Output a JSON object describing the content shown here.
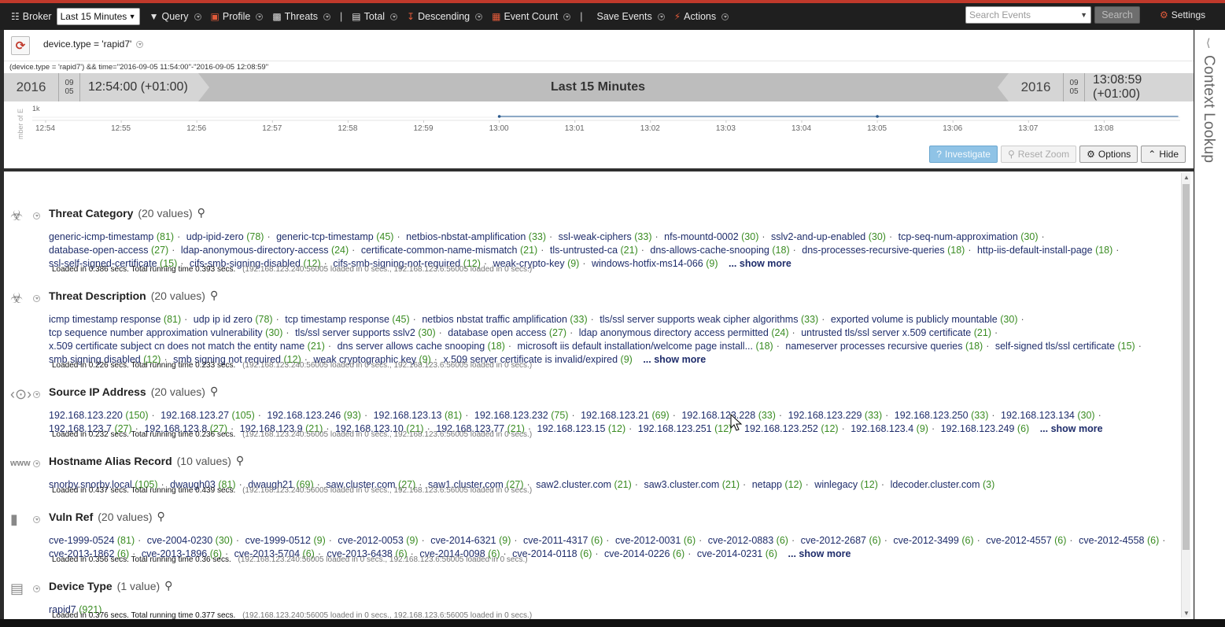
{
  "toolbar": {
    "broker": "Broker",
    "time_range": "Last 15 Minutes",
    "query": "Query",
    "profile": "Profile",
    "threats": "Threats",
    "total": "Total",
    "descending": "Descending",
    "event_count": "Event Count",
    "save_events": "Save Events",
    "actions": "Actions",
    "search_placeholder": "Search Events",
    "search_button": "Search",
    "settings": "Settings"
  },
  "query": {
    "pill": "device.type = 'rapid7'",
    "string": "(device.type = 'rapid7') && time=\"2016-09-05 11:54:00\"-\"2016-09-05 12:08:59\""
  },
  "timeline": {
    "start_year": "2016",
    "start_month": "09",
    "start_day": "05",
    "start_time": "12:54:00 (+01:00)",
    "label": "Last 15 Minutes",
    "end_year": "2016",
    "end_month": "09",
    "end_day": "05",
    "end_time": "13:08:59 (+01:00)"
  },
  "chart_data": {
    "type": "line",
    "title": "",
    "xlabel": "",
    "ylabel": "mber of E",
    "y_tick": "1k",
    "categories": [
      "12:54",
      "12:55",
      "12:56",
      "12:57",
      "12:58",
      "12:59",
      "13:00",
      "13:01",
      "13:02",
      "13:03",
      "13:04",
      "13:05",
      "13:06",
      "13:07",
      "13:08"
    ],
    "x": [
      0,
      1,
      2,
      3,
      4,
      5,
      6,
      7,
      8,
      9,
      10,
      11,
      12,
      13,
      14,
      14.98
    ],
    "values": [
      null,
      null,
      null,
      null,
      null,
      null,
      0,
      0,
      0,
      0,
      0,
      0,
      0,
      0,
      0,
      0
    ],
    "marker_x": [
      6,
      11
    ],
    "ylim": [
      0,
      1000
    ],
    "line_color": "#6a8fb5"
  },
  "chart_buttons": {
    "investigate": "Investigate",
    "reset_zoom": "Reset Zoom",
    "options": "Options",
    "hide": "Hide"
  },
  "meta": [
    {
      "icon": "biohazard-icon",
      "name": "Threat Category",
      "count": "(20 values)",
      "values": [
        [
          "generic-icmp-timestamp",
          "(81)"
        ],
        [
          "udp-ipid-zero",
          "(78)"
        ],
        [
          "generic-tcp-timestamp",
          "(45)"
        ],
        [
          "netbios-nbstat-amplification",
          "(33)"
        ],
        [
          "ssl-weak-ciphers",
          "(33)"
        ],
        [
          "nfs-mountd-0002",
          "(30)"
        ],
        [
          "sslv2-and-up-enabled",
          "(30)"
        ],
        [
          "tcp-seq-num-approximation",
          "(30)"
        ],
        [
          "database-open-access",
          "(27)"
        ],
        [
          "ldap-anonymous-directory-access",
          "(24)"
        ],
        [
          "certificate-common-name-mismatch",
          "(21)"
        ],
        [
          "tls-untrusted-ca",
          "(21)"
        ],
        [
          "dns-allows-cache-snooping",
          "(18)"
        ],
        [
          "dns-processes-recursive-queries",
          "(18)"
        ],
        [
          "http-iis-default-install-page",
          "(18)"
        ],
        [
          "ssl-self-signed-certificate",
          "(15)"
        ],
        [
          "cifs-smb-signing-disabled",
          "(12)"
        ],
        [
          "cifs-smb-signing-not-required",
          "(12)"
        ],
        [
          "weak-crypto-key",
          "(9)"
        ],
        [
          "windows-hotfix-ms14-066",
          "(9)"
        ]
      ],
      "more": "... show more",
      "loaded": "Loaded in 0.386 secs. Total running time 0.393 secs.",
      "detail": "(192.168.123.240:56005 loaded in 0 secs., 192.168.123.6:56005 loaded in 0 secs.)"
    },
    {
      "icon": "biohazard-icon",
      "name": "Threat Description",
      "count": "(20 values)",
      "values": [
        [
          "icmp timestamp response",
          "(81)"
        ],
        [
          "udp ip id zero",
          "(78)"
        ],
        [
          "tcp timestamp response",
          "(45)"
        ],
        [
          "netbios nbstat traffic amplification",
          "(33)"
        ],
        [
          "tls/ssl server supports weak cipher algorithms",
          "(33)"
        ],
        [
          "exported volume is publicly mountable",
          "(30)"
        ],
        [
          "tcp sequence number approximation vulnerability",
          "(30)"
        ],
        [
          "tls/ssl server supports sslv2",
          "(30)"
        ],
        [
          "database open access",
          "(27)"
        ],
        [
          "ldap anonymous directory access permitted",
          "(24)"
        ],
        [
          "untrusted tls/ssl server x.509 certificate",
          "(21)"
        ],
        [
          "x.509 certificate subject cn does not match the entity name",
          "(21)"
        ],
        [
          "dns server allows cache snooping",
          "(18)"
        ],
        [
          "microsoft iis default installation/welcome page install...",
          "(18)"
        ],
        [
          "nameserver processes recursive queries",
          "(18)"
        ],
        [
          "self-signed tls/ssl certificate",
          "(15)"
        ],
        [
          "smb signing disabled",
          "(12)"
        ],
        [
          "smb signing not required",
          "(12)"
        ],
        [
          "weak cryptographic key",
          "(9)"
        ],
        [
          "x.509 server certificate is invalid/expired",
          "(9)"
        ]
      ],
      "more": "... show more",
      "loaded": "Loaded in 0.226 secs. Total running time 0.233 secs.",
      "detail": "(192.168.123.240:56005 loaded in 0 secs., 192.168.123.6:56005 loaded in 0 secs.)"
    },
    {
      "icon": "network-address-icon",
      "name": "Source IP Address",
      "count": "(20 values)",
      "values": [
        [
          "192.168.123.220",
          "(150)"
        ],
        [
          "192.168.123.27",
          "(105)"
        ],
        [
          "192.168.123.246",
          "(93)"
        ],
        [
          "192.168.123.13",
          "(81)"
        ],
        [
          "192.168.123.232",
          "(75)"
        ],
        [
          "192.168.123.21",
          "(69)"
        ],
        [
          "192.168.123.228",
          "(33)"
        ],
        [
          "192.168.123.229",
          "(33)"
        ],
        [
          "192.168.123.250",
          "(33)"
        ],
        [
          "192.168.123.134",
          "(30)"
        ],
        [
          "192.168.123.7",
          "(27)"
        ],
        [
          "192.168.123.8",
          "(27)"
        ],
        [
          "192.168.123.9",
          "(21)"
        ],
        [
          "192.168.123.10",
          "(21)"
        ],
        [
          "192.168.123.77",
          "(21)"
        ],
        [
          "192.168.123.15",
          "(12)"
        ],
        [
          "192.168.123.251",
          "(12)"
        ],
        [
          "192.168.123.252",
          "(12)"
        ],
        [
          "192.168.123.4",
          "(9)"
        ],
        [
          "192.168.123.249",
          "(6)"
        ]
      ],
      "more": "... show more",
      "loaded": "Loaded in 0.232 secs. Total running time 0.236 secs.",
      "detail": "(192.168.123.240:56005 loaded in 0 secs., 192.168.123.6:56005 loaded in 0 secs.)"
    },
    {
      "icon": "www-icon",
      "icon_text": "www",
      "name": "Hostname Alias Record",
      "count": "(10 values)",
      "values": [
        [
          "snorby.snorby.local",
          "(105)"
        ],
        [
          "dwaugh03",
          "(81)"
        ],
        [
          "dwaugh21",
          "(69)"
        ],
        [
          "saw.cluster.com",
          "(27)"
        ],
        [
          "saw1.cluster.com",
          "(27)"
        ],
        [
          "saw2.cluster.com",
          "(21)"
        ],
        [
          "saw3.cluster.com",
          "(21)"
        ],
        [
          "netapp",
          "(12)"
        ],
        [
          "winlegacy",
          "(12)"
        ],
        [
          "ldecoder.cluster.com",
          "(3)"
        ]
      ],
      "more": "",
      "loaded": "Loaded in 0.437 secs. Total running time 0.439 secs.",
      "detail": "(192.168.123.240:56005 loaded in 0 secs., 192.168.123.6:56005 loaded in 0 secs.)"
    },
    {
      "icon": "bookmark-icon",
      "name": "Vuln Ref",
      "count": "(20 values)",
      "values": [
        [
          "cve-1999-0524",
          "(81)"
        ],
        [
          "cve-2004-0230",
          "(30)"
        ],
        [
          "cve-1999-0512",
          "(9)"
        ],
        [
          "cve-2012-0053",
          "(9)"
        ],
        [
          "cve-2014-6321",
          "(9)"
        ],
        [
          "cve-2011-4317",
          "(6)"
        ],
        [
          "cve-2012-0031",
          "(6)"
        ],
        [
          "cve-2012-0883",
          "(6)"
        ],
        [
          "cve-2012-2687",
          "(6)"
        ],
        [
          "cve-2012-3499",
          "(6)"
        ],
        [
          "cve-2012-4557",
          "(6)"
        ],
        [
          "cve-2012-4558",
          "(6)"
        ],
        [
          "cve-2013-1862",
          "(6)"
        ],
        [
          "cve-2013-1896",
          "(6)"
        ],
        [
          "cve-2013-5704",
          "(6)"
        ],
        [
          "cve-2013-6438",
          "(6)"
        ],
        [
          "cve-2014-0098",
          "(6)"
        ],
        [
          "cve-2014-0118",
          "(6)"
        ],
        [
          "cve-2014-0226",
          "(6)"
        ],
        [
          "cve-2014-0231",
          "(6)"
        ]
      ],
      "more": "... show more",
      "loaded": "Loaded in 0.356 secs. Total running time 0.36 secs.",
      "detail": "(192.168.123.240:56005 loaded in 0 secs., 192.168.123.6:56005 loaded in 0 secs.)"
    },
    {
      "icon": "device-icon",
      "name": "Device Type",
      "count": "(1 value)",
      "values": [
        [
          "rapid7",
          "(921)"
        ]
      ],
      "more": "",
      "loaded": "Loaded in 0.376 secs. Total running time 0.377 secs.",
      "detail": "(192.168.123.240:56005 loaded in 0 secs., 192.168.123.6:56005 loaded in 0 secs.)"
    }
  ],
  "side_panel": {
    "label": "Context Lookup"
  }
}
